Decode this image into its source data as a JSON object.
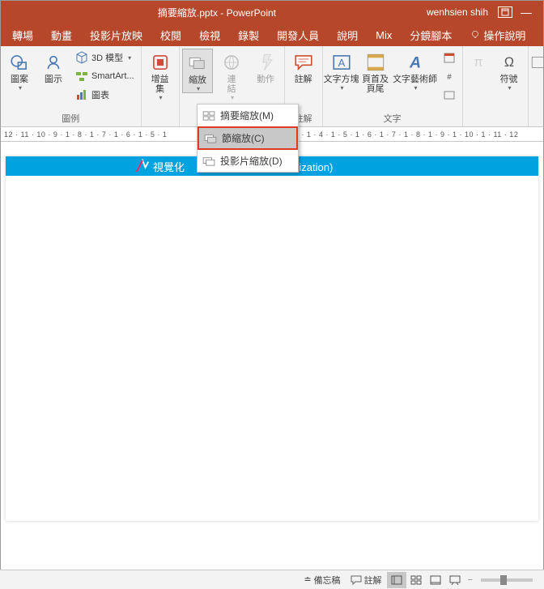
{
  "titlebar": {
    "doc": "摘要縮放.pptx",
    "app": "PowerPoint",
    "user": "wenhsien shih"
  },
  "tabs": [
    "轉場",
    "動畫",
    "投影片放映",
    "校閱",
    "檢視",
    "錄製",
    "開發人員",
    "說明",
    "Mix",
    "分鏡腳本"
  ],
  "help": "操作說明",
  "ribbon": {
    "illus": {
      "label": "圖例",
      "img": "圖案",
      "icon": "圖示",
      "model3d": "3D 模型",
      "smartart": "SmartArt...",
      "chart": "圖表"
    },
    "addin": {
      "label": "增益集",
      "btn": "增益\n集"
    },
    "zoom": {
      "label": "縮放",
      "btn": "縮放"
    },
    "link": {
      "label": "連結",
      "btn": "連\n結"
    },
    "action": {
      "btn": "動作"
    },
    "comment": {
      "label": "註解",
      "btn": "註解"
    },
    "text": {
      "label": "文字",
      "textbox": "文字方塊",
      "headfoot": "頁首及\n頁尾",
      "wordart": "文字藝術師",
      "equation": "符號"
    }
  },
  "dropdown": {
    "m": "摘要縮放(M)",
    "c": "節縮放(C)",
    "d": "投影片縮放(D)"
  },
  "ruler1": "12 · 11 · 10 · 9 · 1 · 8 · 1 · 7 · 1 · 6 · 1 · 5 · 1",
  "ruler2": "· 1 · 3 · 1 · 4 · 1 · 5 · 1 · 6 · 1 · 7 · 1 · 8 · 1 · 9 · 1 · 10 · 1 · 11 · 12",
  "slide": {
    "title": "視覺化",
    "sub": "ormation Visualization)"
  },
  "status": {
    "notes": "備忘稿",
    "comments": "註解"
  }
}
